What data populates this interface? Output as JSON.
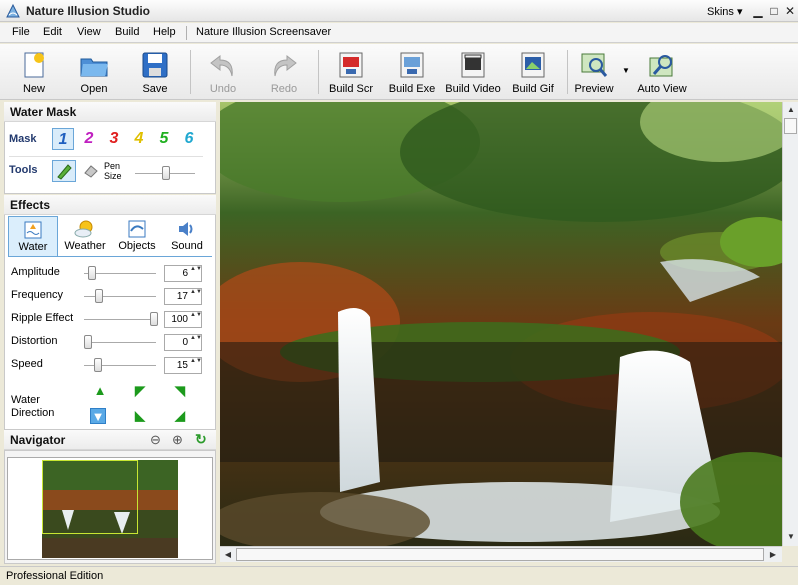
{
  "window": {
    "title": "Nature Illusion Studio",
    "skins_label": "Skins ▾",
    "minimize": "▁",
    "maximize": "□",
    "close": "✕"
  },
  "menu": {
    "items": [
      "File",
      "Edit",
      "View",
      "Build",
      "Help"
    ],
    "extra": "Nature Illusion Screensaver"
  },
  "toolbar": {
    "new": "New",
    "open": "Open",
    "save": "Save",
    "undo": "Undo",
    "redo": "Redo",
    "build_scr": "Build Scr",
    "build_exe": "Build Exe",
    "build_video": "Build Video",
    "build_gif": "Build Gif",
    "preview": "Preview",
    "auto_view": "Auto View"
  },
  "water_mask": {
    "title": "Water Mask",
    "mask_label": "Mask",
    "masks": [
      "1",
      "2",
      "3",
      "4",
      "5",
      "6"
    ],
    "mask_colors": [
      "#1f5fbf",
      "#c020c0",
      "#e02020",
      "#e0c000",
      "#20b020",
      "#20a8d0"
    ],
    "tools_label": "Tools",
    "pen_size_label": "Pen Size",
    "pen_size_level": 0.5
  },
  "effects": {
    "title": "Effects",
    "tabs": [
      "Water",
      "Weather",
      "Objects",
      "Sound"
    ],
    "params": [
      {
        "label": "Amplitude",
        "value": "6",
        "level": 0.06
      },
      {
        "label": "Frequency",
        "value": "17",
        "level": 0.17
      },
      {
        "label": "Ripple Effect",
        "value": "100",
        "level": 1.0
      },
      {
        "label": "Distortion",
        "value": "0",
        "level": 0.0
      },
      {
        "label": "Speed",
        "value": "15",
        "level": 0.15
      }
    ],
    "direction_label": "Water Direction"
  },
  "navigator": {
    "title": "Navigator"
  },
  "status": {
    "text": "Professional Edition"
  }
}
